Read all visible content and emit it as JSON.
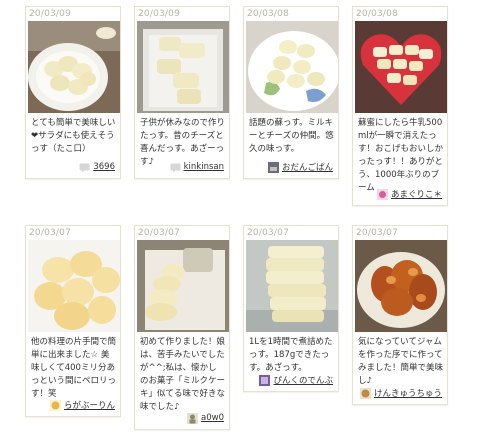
{
  "cards": [
    {
      "date": "20/03/09",
      "text": "とても簡単で美味しい❤サラダにも使えそうっす（たこ口）",
      "author": "3696",
      "avatar_icon": "speech-bubble-icon",
      "avatar_color": "#c9c9c9"
    },
    {
      "date": "20/03/09",
      "text": "子供が休みなので作りたっす。昔のチーズと喜んだっす。あざーっす♪",
      "author": "kinkinsan",
      "avatar_icon": "speech-bubble-icon",
      "avatar_color": "#c9c9c9"
    },
    {
      "date": "20/03/08",
      "text": "話題の蘇っす。ミルキーとチーズの仲間。悠久の味っす。",
      "author": "おだんごぱん",
      "avatar_icon": "user-avatar-icon",
      "avatar_color": "#6b6b80"
    },
    {
      "date": "20/03/08",
      "text": "蘇蜜にしたら牛乳500mlが一瞬で消えたっす！おこげもおいしかったっす！！ありがとう、1000年ぶりのブーム",
      "author": "あまぐりこ＊",
      "avatar_icon": "user-avatar-icon",
      "avatar_color": "#d4609a"
    },
    {
      "date": "20/03/07",
      "text": "他の料理の片手間で簡単に出来ました☆ 美味しくて400ミリ分あっという間にペロリっす！笑",
      "author": "らがぶーりん",
      "avatar_icon": "user-avatar-icon",
      "avatar_color": "#e3b84f"
    },
    {
      "date": "20/03/07",
      "text": "初めて作りました！娘は、苦手みたいでしたが^^;私は、懐かしのお菓子「ミルクケーキ」似てる味で好きな味でした♪",
      "author": "a0w0",
      "avatar_icon": "user-avatar-icon",
      "avatar_color": "#8a8a6e"
    },
    {
      "date": "20/03/07",
      "text": "1Lを1時間で煮詰めたっす。187gできたっす。あざっす。",
      "author": "ぴんくのでんぶ",
      "avatar_icon": "user-avatar-icon",
      "avatar_color": "#7a5aa0"
    },
    {
      "date": "20/03/07",
      "text": "気になっていてジャムを作った序でに作ってみました！簡単で美味し♪",
      "author": "けんきゅうちゅう",
      "avatar_icon": "user-avatar-icon",
      "avatar_color": "#b98a4a"
    }
  ]
}
